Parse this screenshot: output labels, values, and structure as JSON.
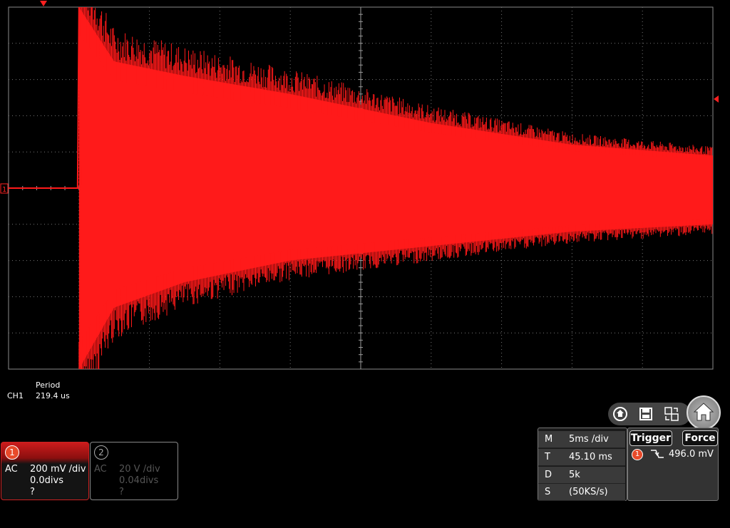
{
  "measurement": {
    "name": "Period",
    "channel": "CH1",
    "value": "219.4 us"
  },
  "channels": [
    {
      "number": "1",
      "coupling": "AC",
      "scale": "200 mV /div",
      "offset": "0.0divs",
      "extra": "?",
      "active": true,
      "color": "#ff1a1a"
    },
    {
      "number": "2",
      "coupling": "AC",
      "scale": "20 V /div",
      "offset": "0.04divs",
      "extra": "?",
      "active": false
    }
  ],
  "ground_marker": "1",
  "timebase": {
    "rows": [
      {
        "key": "M",
        "value": "5ms /div"
      },
      {
        "key": "T",
        "value": "45.10 ms"
      },
      {
        "key": "D",
        "value": "5k"
      },
      {
        "key": "S",
        "value": "(50KS/s)"
      }
    ]
  },
  "trigger": {
    "trigger_label": "Trigger",
    "force_label": "Force",
    "source": "1",
    "slope": "falling-edge-icon",
    "level": "496.0 mV"
  },
  "toolbar": {
    "icons": [
      "auto-set-icon",
      "save-icon",
      "display-switch-icon",
      "home-icon"
    ]
  },
  "chart_data": {
    "type": "line",
    "grid": "10 x 10 divisions",
    "x_unit": "5ms /div",
    "y_unit": "200 mV /div",
    "description_series": [
      {
        "name": "CH1",
        "color": "#ff1a1a"
      }
    ],
    "envelope": {
      "pre_trigger_level_div": 0,
      "trigger_position_div": 1.0,
      "points": [
        {
          "t_div": 1.0,
          "upper": 5.0,
          "lower": -5.0
        },
        {
          "t_div": 1.5,
          "upper": 3.5,
          "lower": -3.3
        },
        {
          "t_div": 2.5,
          "upper": 3.1,
          "lower": -2.6
        },
        {
          "t_div": 4.0,
          "upper": 2.6,
          "lower": -2.0
        },
        {
          "t_div": 6.0,
          "upper": 1.8,
          "lower": -1.6
        },
        {
          "t_div": 8.0,
          "upper": 1.2,
          "lower": -1.2
        },
        {
          "t_div": 10.0,
          "upper": 0.9,
          "lower": -1.0
        }
      ]
    }
  }
}
